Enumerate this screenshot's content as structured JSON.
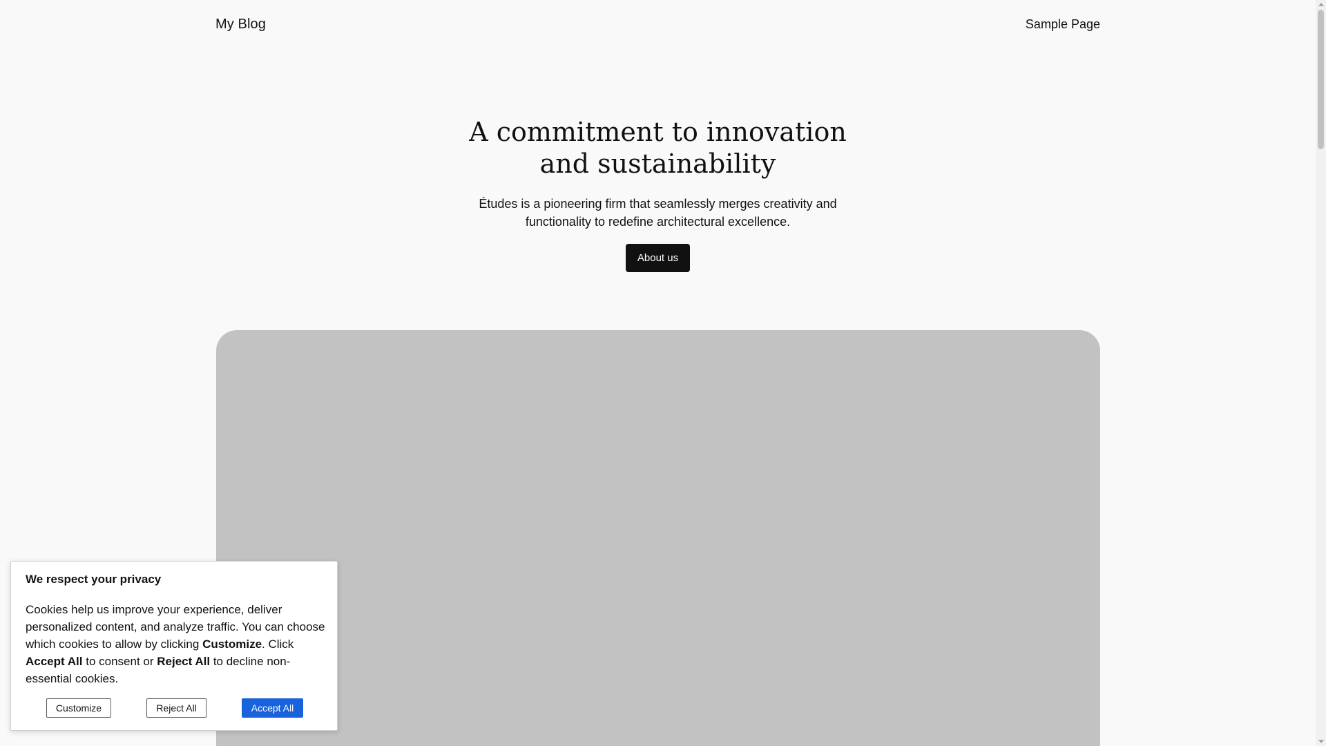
{
  "header": {
    "site_title": "My Blog",
    "nav": [
      {
        "label": "Sample Page"
      }
    ]
  },
  "hero": {
    "title": "A commitment to innovation and sustainability",
    "description": "Études is a pioneering firm that seamlessly merges creativity and functionality to redefine architectural excellence.",
    "button_label": "About us"
  },
  "cookie_banner": {
    "title": "We respect your privacy",
    "text_parts": {
      "p1": "Cookies help us improve your experience, deliver personalized content, and analyze traffic. You can choose which cookies to allow by clicking ",
      "b1": "Customize",
      "p2": ". Click ",
      "b2": "Accept All",
      "p3": " to consent or ",
      "b3": "Reject All",
      "p4": " to decline non-essential cookies."
    },
    "buttons": {
      "customize": "Customize",
      "reject": "Reject All",
      "accept": "Accept All"
    }
  },
  "colors": {
    "background": "#f9f9f9",
    "text": "#111111",
    "primary_button": "#111111",
    "accept_button": "#1863dc",
    "image_placeholder": "#c2c2c2"
  }
}
